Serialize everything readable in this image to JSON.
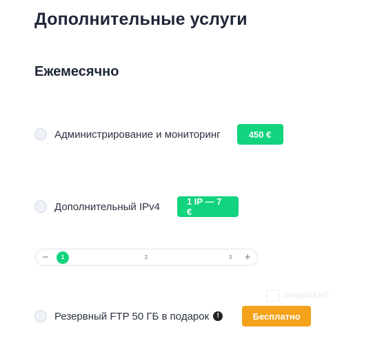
{
  "page": {
    "title": "Дополнительные услуги",
    "subtitle": "Ежемесячно"
  },
  "services": [
    {
      "label": "Администрирование и мониторинг",
      "price": "450 €",
      "checked": false
    },
    {
      "label": "Дополнительный IPv4",
      "price": "1 IP — 7 €",
      "checked": false
    },
    {
      "label": "Резервный FTP 50 ГБ в подарок",
      "price": "Бесплатно",
      "checked": false,
      "info_icon": "!"
    }
  ],
  "ip_stepper": {
    "minus": "−",
    "plus": "+",
    "steps": [
      "1",
      "2",
      "3"
    ],
    "selected": "1"
  },
  "watermark": {
    "text": "ЗАЩИЩЕНО"
  },
  "colors": {
    "accent_green": "#12d37e",
    "accent_orange": "#f4a21b",
    "heading": "#1f2738"
  }
}
